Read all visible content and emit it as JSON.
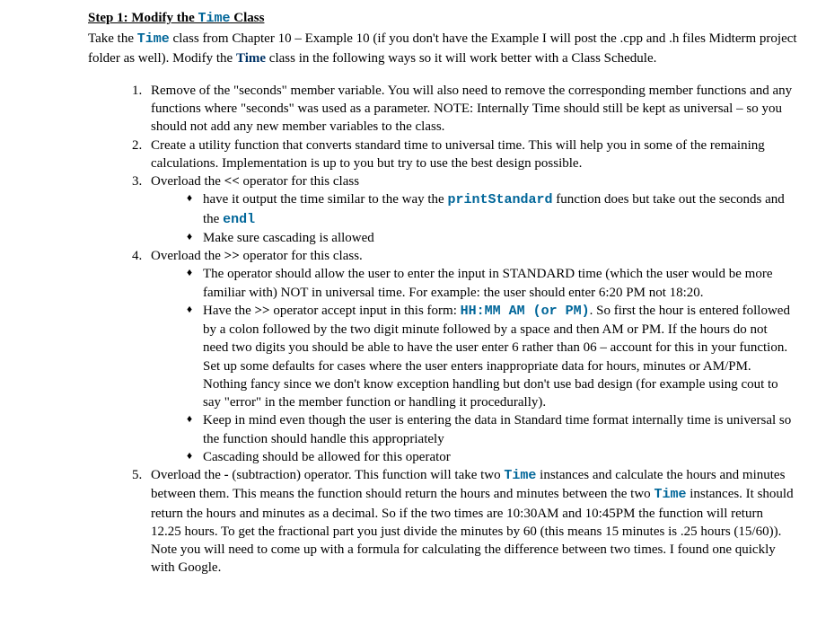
{
  "heading": {
    "prefix": "Step 1:  Modify the ",
    "code": "Time",
    "suffix": " Class"
  },
  "intro": {
    "p1a": "Take the ",
    "p1code": "Time",
    "p1b": " class from Chapter 10 – Example 10 (if you don't have the Example I will post the .cpp and .h files Midterm project folder as well).  Modify the ",
    "p1bold": "Time",
    "p1c": " class in the following ways so it will work better with a Class Schedule."
  },
  "items": {
    "i1": "Remove of the \"seconds\" member variable.  You will also need to remove the corresponding member functions and any functions where \"seconds\" was used as a parameter.  NOTE:  Internally Time should still be kept as universal – so you should not add any new member variables to the class.",
    "i2": "Create a utility function that converts standard time to universal time.  This will help you in some of the remaining calculations.  Implementation is up to you but try to use the best design possible.",
    "i3": {
      "a": "Overload the ",
      "op": "<<",
      "b": " operator for this class",
      "sub1a": "have it output the time similar to the way the ",
      "sub1code1": "printStandard",
      "sub1b": " function does but take out the seconds and the ",
      "sub1code2": "endl",
      "sub2": "Make sure cascading is allowed"
    },
    "i4": {
      "a": "Overload the ",
      "op": ">>",
      "b": " operator for this class.",
      "sub1": "The operator should allow the user to enter the input in STANDARD time (which the user would be more familiar with) NOT in universal time.  For example: the user should enter 6:20 PM not 18:20.",
      "sub2a": "Have the ",
      "sub2op": ">>",
      "sub2b": " operator accept input in this form:  ",
      "sub2code": "HH:MM AM (or PM)",
      "sub2c": ".  So first the hour is entered followed by a colon followed by the two digit minute followed by a space and then AM or PM.  If the hours do not need two digits you should be able to have the user enter 6 rather than 06 – account for this in your function.  Set up some defaults for cases where the user enters inappropriate data for hours, minutes or AM/PM.  Nothing fancy since we don't know exception handling but don't use bad design (for example using cout to say \"error\" in the member function or handling it procedurally).",
      "sub3": "Keep in mind even though the user is entering the data in Standard time format internally time is universal so the function should handle this appropriately",
      "sub4": "Cascading should be allowed for this operator"
    },
    "i5": {
      "a": "Overload the ",
      "op": "-",
      "b": "  (subtraction) operator.  This function will take two ",
      "code1": "Time",
      "c": " instances and calculate the hours and minutes between them.  This means the function should return the hours and minutes between the two ",
      "code2": "Time",
      "d": " instances. It should return the hours and minutes as a decimal.  So if the two times are 10:30AM and 10:45PM the function will return 12.25 hours.  To get the fractional part you just divide the minutes by 60 (this means 15 minutes is .25 hours (15/60)).  Note you will need to come up with a formula for calculating the difference between two times.  I found one quickly with Google."
    }
  }
}
